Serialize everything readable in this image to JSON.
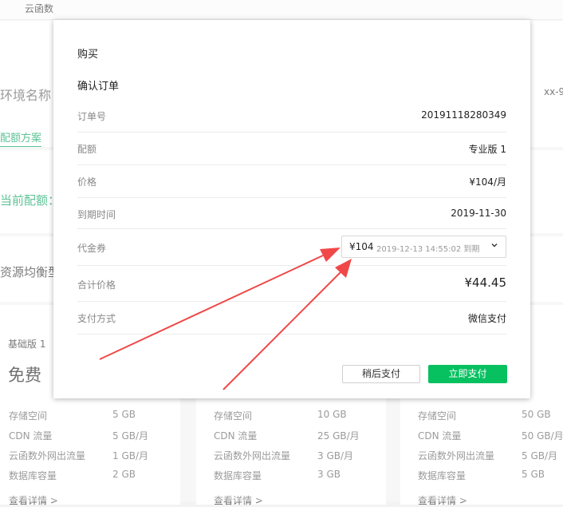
{
  "background": {
    "tab_label": "云函数",
    "env_name_label": "环境名称",
    "env_id_fragment": "xx-9",
    "quota_plan_link": "配额方案",
    "current_quota_label": "当前配额：",
    "balance_label": "资源均衡型",
    "cards": [
      {
        "title": "基础版 1",
        "price": "免费",
        "specs": [
          {
            "name": "存储空间",
            "value": "5 GB"
          },
          {
            "name": "CDN 流量",
            "value": "5 GB/月"
          },
          {
            "name": "云函数外网出流量",
            "value": "1 GB/月"
          },
          {
            "name": "数据库容量",
            "value": "2 GB"
          }
        ],
        "more_link": "查看详情 >"
      },
      {
        "title": "",
        "price": "",
        "specs": [
          {
            "name": "存储空间",
            "value": "10 GB"
          },
          {
            "name": "CDN 流量",
            "value": "25 GB/月"
          },
          {
            "name": "云函数外网出流量",
            "value": "3 GB/月"
          },
          {
            "name": "数据库容量",
            "value": "3 GB"
          }
        ],
        "more_link": "查看详情 >"
      },
      {
        "title": "",
        "price": "",
        "specs": [
          {
            "name": "存储空间",
            "value": "50 GB"
          },
          {
            "name": "CDN 流量",
            "value": "50 GB/月"
          },
          {
            "name": "云函数外网出流量",
            "value": "5 GB/月"
          },
          {
            "name": "数据库容量",
            "value": "5 GB"
          }
        ],
        "more_link": "查看详情 >"
      }
    ]
  },
  "dialog": {
    "title": "购买",
    "section_title": "确认订单",
    "rows": {
      "order_no": {
        "label": "订单号",
        "value": "20191118280349"
      },
      "quota": {
        "label": "配额",
        "value": "专业版 1"
      },
      "price": {
        "label": "价格",
        "value": "¥104/月"
      },
      "expire": {
        "label": "到期时间",
        "value": "2019-11-30"
      },
      "voucher": {
        "label": "代金券",
        "amount": "¥104",
        "expiry": "2019-12-13 14:55:02 到期"
      },
      "total": {
        "label": "合计价格",
        "value": "¥44.45"
      },
      "payment": {
        "label": "支付方式",
        "value": "微信支付"
      }
    },
    "pay_later_button": "稍后支付",
    "pay_now_button": "立即支付"
  },
  "colors": {
    "accent_green": "#07c160",
    "link_green": "#07a35f",
    "annotation_red": "#f04848"
  }
}
